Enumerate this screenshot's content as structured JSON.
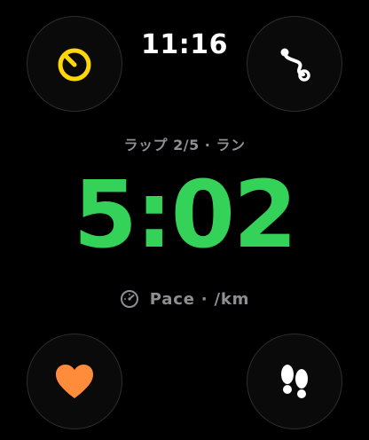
{
  "status": {
    "time": "11:16"
  },
  "workout": {
    "lap_label": "ラップ 2/5 · ラン",
    "pace_value": "5:02",
    "pace_unit_label": "Pace · /km"
  },
  "controls": {
    "top_left_icon": "timer-icon",
    "top_right_icon": "route-icon",
    "bottom_left_icon": "heart-icon",
    "bottom_right_icon": "footsteps-icon"
  },
  "colors": {
    "accent_yellow": "#ffd60a",
    "pace_green": "#35d25a",
    "heart_orange": "#ff8c3a",
    "label_gray": "#8e8e93"
  }
}
